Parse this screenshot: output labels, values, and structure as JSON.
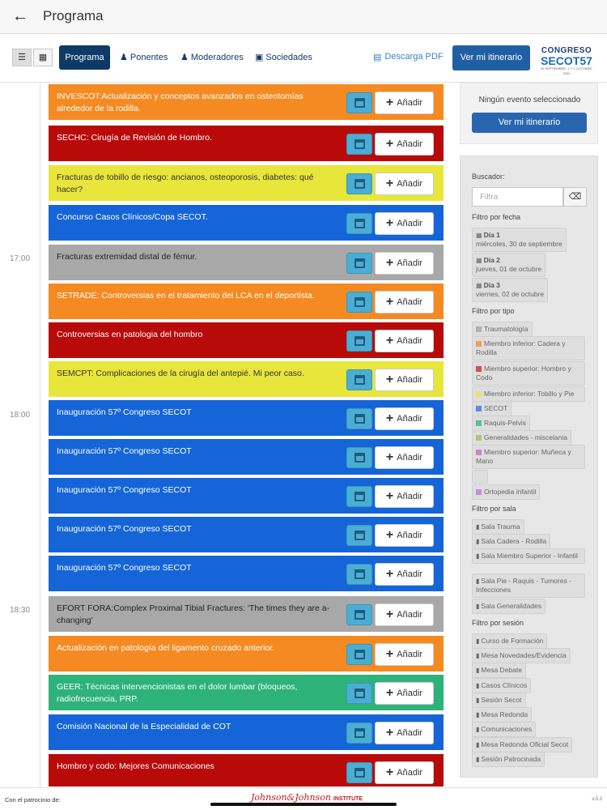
{
  "nav": {
    "title": "Programa"
  },
  "toolbar": {
    "programa": "Programa",
    "ponentes": "Ponentes",
    "moderadores": "Moderadores",
    "sociedades": "Sociedades",
    "pdf": "Descarga PDF",
    "itinerary": "Ver mi itinerario"
  },
  "logo": {
    "line1": "CONGRESO",
    "line2": "SECOT57",
    "line3": "30 SEPTIEMBRE, 1 Y 2 OCTUBRE, 2020"
  },
  "times": [
    "17:00",
    "18:00",
    "18:30"
  ],
  "add_label": "Añadir",
  "events": [
    {
      "title": "INVESCOT:Actualización y conceptos avanzados en osteotomías alrededor de la rodilla.",
      "color": "orange"
    },
    {
      "title": "SECHC: Cirugía de Revisión de Hombro.",
      "color": "red"
    },
    {
      "title": "Fracturas de tobillo de riesgo: ancianos, osteoporosis, diabetes: qué hacer?",
      "color": "yellow"
    },
    {
      "title": "Concurso Casos Clínicos/Copa SECOT.",
      "color": "blue"
    },
    {
      "title": "Fracturas extremidad distal de fémur.",
      "color": "gray"
    },
    {
      "title": "SETRADE: Controversias en el tratamiento del LCA en el deportista.",
      "color": "orange"
    },
    {
      "title": "Controversias en patologia del hombro",
      "color": "red"
    },
    {
      "title": "SEMCPT: Complicaciones de la cirugía del antepié. Mi peor caso.",
      "color": "yellow"
    },
    {
      "title": "Inauguración 57º Congreso SECOT",
      "color": "blue"
    },
    {
      "title": "Inauguración 57º Congreso SECOT",
      "color": "blue"
    },
    {
      "title": "Inauguración 57º Congreso SECOT",
      "color": "blue"
    },
    {
      "title": "Inauguración 57º Congreso SECOT",
      "color": "blue"
    },
    {
      "title": "Inauguración 57º Congreso SECOT",
      "color": "blue"
    },
    {
      "title": "EFORT FORA:Complex Proximal Tibial Fractures: 'The times they are a-changing'",
      "color": "gray"
    },
    {
      "title": "Actualización en patología del ligamento cruzado anterior.",
      "color": "orange"
    },
    {
      "title": "GEER: Técnicas intervencionistas en el dolor lumbar (bloqueos, radiofrecuencia, PRP.",
      "color": "green"
    },
    {
      "title": "Comisión Nacional de la Especialidad de COT",
      "color": "blue"
    },
    {
      "title": "Hombro y codo: Mejores Comunicaciones",
      "color": "red"
    }
  ],
  "sidebar": {
    "no_event": "Ningún evento seleccionado",
    "itinerary": "Ver mi itinerario",
    "search_label": "Buscador:",
    "search_placeholder": "Filtra",
    "date_label": "Filtro por fecha",
    "dates": [
      {
        "day": "Día 1",
        "date": "miércoles, 30 de septiembre"
      },
      {
        "day": "Día 2",
        "date": "jueves, 01 de octubre"
      },
      {
        "day": "Día 3",
        "date": "viernes, 02 de octubre"
      }
    ],
    "type_label": "Filtro por tipo",
    "types": [
      {
        "name": "Traumatología",
        "color": "#b0b0b0"
      },
      {
        "name": "Miembro inferior: Cadera y Rodilla",
        "color": "#f0a05a"
      },
      {
        "name": "Miembro superior: Hombro y Codo",
        "color": "#d05050"
      },
      {
        "name": "Miembro inferior: Tobillo y Pie",
        "color": "#e6e66a"
      },
      {
        "name": "SECOT",
        "color": "#5a8ee0"
      },
      {
        "name": "Raquis-Pelvis",
        "color": "#5ac08e"
      },
      {
        "name": "Generalidades - miscelania",
        "color": "#a8c878"
      },
      {
        "name": "Miembro superior: Muñeca y Mano",
        "color": "#d080c8"
      },
      {
        "name": "",
        "color": ""
      },
      {
        "name": "Ortopedia infantil",
        "color": "#c090d8"
      }
    ],
    "room_label": "Filtro por sala",
    "rooms": [
      "Sala Trauma",
      "Sala Cadera - Rodilla",
      "Sala Miembro Superior - Infantil",
      "Sala Pie - Raquis - Tumores - Infecciones",
      "Sala Generalidades"
    ],
    "session_label": "Filtro por sesión",
    "sessions": [
      "Curso de Formación",
      "Mesa Novedades/Evidencia",
      "Mesa Debate",
      "Casos Clínicos",
      "Sesión Secot",
      "Mesa Redonda",
      "Comunicaciones",
      "Mesa Redonda Oficial Secot",
      "Sesión Patrocinada"
    ]
  },
  "footer": {
    "sponsor_label": "Con el patrocinio de:",
    "sponsor": "Johnson&Johnson",
    "sponsor_suffix": "INSTITUTE",
    "version": "v.0.3"
  }
}
